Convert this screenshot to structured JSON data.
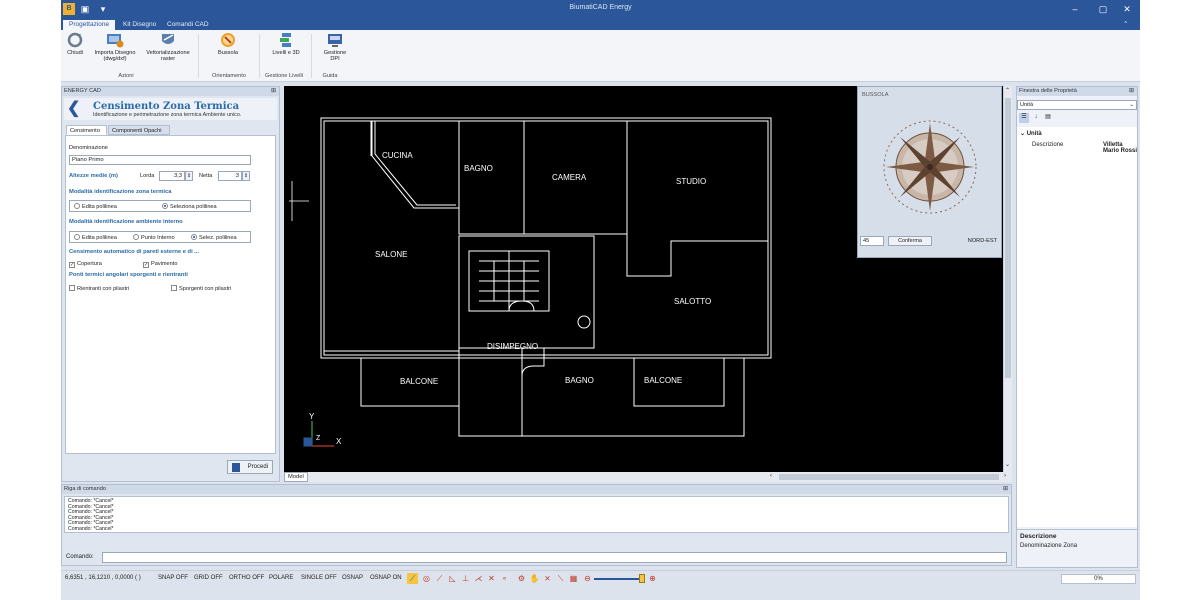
{
  "app": {
    "title": "BiumatiCAD Energy",
    "quick_access": [
      "save-icon",
      "pin-icon"
    ],
    "window_controls": [
      "minimize",
      "maximize",
      "close"
    ]
  },
  "ribbon": {
    "tabs": [
      "Progettazione",
      "Kit Disegno",
      "Comandi CAD"
    ],
    "active_tab": "Progettazione",
    "buttons": [
      {
        "label": "Chiudi",
        "icon": "close-circle-icon"
      },
      {
        "label": "Importa Disegno (dwg/dxf)",
        "icon": "import-drawing-icon"
      },
      {
        "label": "Vettorializzazione raster",
        "icon": "vectorize-icon"
      },
      {
        "label": "Bussola",
        "icon": "compass-icon"
      },
      {
        "label": "Livelli e 3D",
        "icon": "layers-icon"
      },
      {
        "label": "Gestione DPI",
        "icon": "dpi-icon"
      }
    ],
    "groups": [
      "Azioni",
      "Orientamento",
      "Gestione Livelli",
      "Guida"
    ]
  },
  "left_panel": {
    "title": "ENERGY CAD",
    "header_title": "Censimento Zona Termica",
    "header_subtitle": "Identificazione e perimetrazione zona termica Ambiente unico.",
    "tabs": [
      "Censimento",
      "Componenti Opachi"
    ],
    "denominazione_label": "Denominazione",
    "denominazione_value": "Piano Primo",
    "altezze_label": "Altezze medie (m)",
    "lorda_label": "Lorda",
    "lorda_value": "3,3",
    "netta_label": "Netta",
    "netta_value": "3",
    "sect_zona": "Modalità identificazione zona termica",
    "zona_opt1": "Edita polilinea",
    "zona_opt2": "Seleziona polilinea",
    "sect_ambiente": "Modalità identificazione ambiente interno",
    "amb_opt1": "Edita polilinea",
    "amb_opt2": "Punto Interno",
    "amb_opt3": "Selez. polilinea",
    "sect_pareti": "Censimento automatico di pareti esterne e di ...",
    "chk_copertura": "Copertura",
    "chk_pavimento": "Pavimento",
    "sect_ponti": "Ponti termici angolari sporgenti e rientranti",
    "chk_rientranti": "Rientranti con pilastri",
    "chk_sporgenti": "Sporgenti con pilastri",
    "procedi": "Procedi"
  },
  "plan": {
    "rooms": [
      "CUCINA",
      "BAGNO",
      "CAMERA",
      "STUDIO",
      "SALONE",
      "SALOTTO",
      "DISIMPEGNO",
      "BALCONE",
      "BAGNO",
      "BALCONE"
    ],
    "axis_y": "Y",
    "axis_x": "X",
    "axis_z": "Z",
    "model_tab": "Model"
  },
  "compass": {
    "title": "BUSSOLA",
    "angle": "45",
    "confirm": "Conferma",
    "direction": "NORD-EST"
  },
  "properties": {
    "title": "Finestra delle Proprietà",
    "selector": "Unità",
    "category": "Unità",
    "prop_name": "Descrizione",
    "prop_value": "Villetta Mario Rossi",
    "desc_title": "Descrizione",
    "desc_text": "Denominazione Zona"
  },
  "command": {
    "title": "Riga di comando",
    "log": [
      "Comando: *Cancel*",
      "Comando: *Cancel*",
      "Comando: *Cancel*",
      "Comando: *Cancel*",
      "Comando: *Cancel*",
      "Comando: *Cancel*",
      "Comando: *Cancel*"
    ],
    "prompt": "Comando:"
  },
  "status": {
    "coords": "6,6351 , 16,1210 , 0,0000 ( )",
    "toggles": [
      "SNAP OFF",
      "GRID OFF",
      "ORTHO OFF",
      "POLARE",
      "SINGLE OFF",
      "OSNAP",
      "OSNAP ON"
    ],
    "progress": "0%"
  }
}
